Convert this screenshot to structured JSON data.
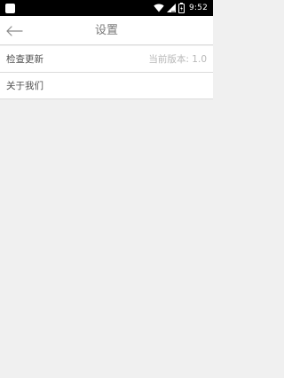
{
  "status_bar": {
    "time": "9:52",
    "icons": [
      "notification-icon",
      "wifi-icon",
      "signal-icon",
      "battery-icon"
    ]
  },
  "header": {
    "title": "设置",
    "back_icon": "arrow-left-icon"
  },
  "settings": {
    "items": [
      {
        "label": "检查更新",
        "value": "当前版本: 1.0"
      },
      {
        "label": "关于我们",
        "value": ""
      }
    ]
  },
  "colors": {
    "status_bar_bg": "#000000",
    "header_bg": "#ffffff",
    "content_bg": "#f0f0f0",
    "divider": "#dcdcdc",
    "title_text": "#7a7a7a",
    "secondary_text": "#b8b8b8"
  }
}
